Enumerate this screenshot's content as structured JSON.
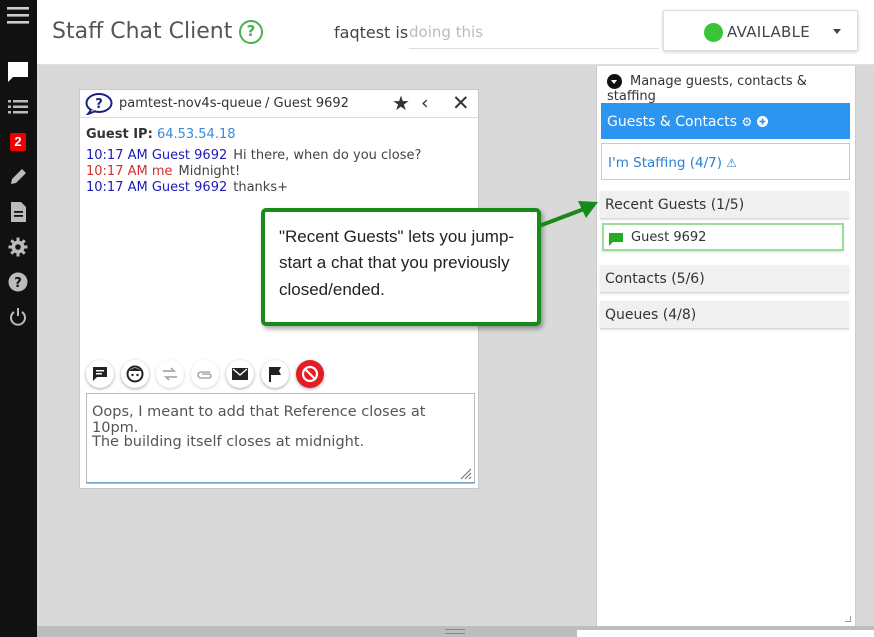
{
  "header": {
    "app_title": "Staff Chat Client",
    "help_glyph": "?",
    "username": "faqtest is",
    "status_placeholder": "doing this",
    "availability": "AVAILABLE",
    "availability_color": "#3ac43a"
  },
  "rail": {
    "badge": "2",
    "icons": [
      "menu-icon",
      "chat-icon",
      "list-icon",
      "badge-icon",
      "pencil-icon",
      "document-icon",
      "gear-icon",
      "help-icon",
      "power-icon"
    ]
  },
  "chat": {
    "queue": "pamtest-nov4s-queue",
    "guest": "/  Guest 9692",
    "guest_ip_label": "Guest IP:",
    "guest_ip": "64.53.54.18",
    "messages": [
      {
        "time": "10:17 AM Guest 9692",
        "text": "Hi there, when do you close?",
        "sender": "guest"
      },
      {
        "time": "10:17 AM me",
        "text": "Midnight!",
        "sender": "me"
      },
      {
        "time": "10:17 AM Guest 9692",
        "text": "thanks+",
        "sender": "guest"
      }
    ],
    "compose_lines": [
      "Oops, I meant to add that Reference closes at 10pm.",
      "The building itself closes at midnight."
    ]
  },
  "panel": {
    "manage_label": "Manage guests, contacts & staffing",
    "guests_contacts": "Guests & Contacts",
    "staffing": "I'm Staffing (4/7)",
    "recent_guests": "Recent Guests (1/5)",
    "recent_item": "Guest 9692",
    "contacts": "Contacts (5/6)",
    "queues": "Queues (4/8)",
    "accent_color": "#2b95f0"
  },
  "callout": {
    "text": "\"Recent Guests\" lets you jump-start a chat that you previously closed/ended.",
    "border_color": "#178a17"
  }
}
